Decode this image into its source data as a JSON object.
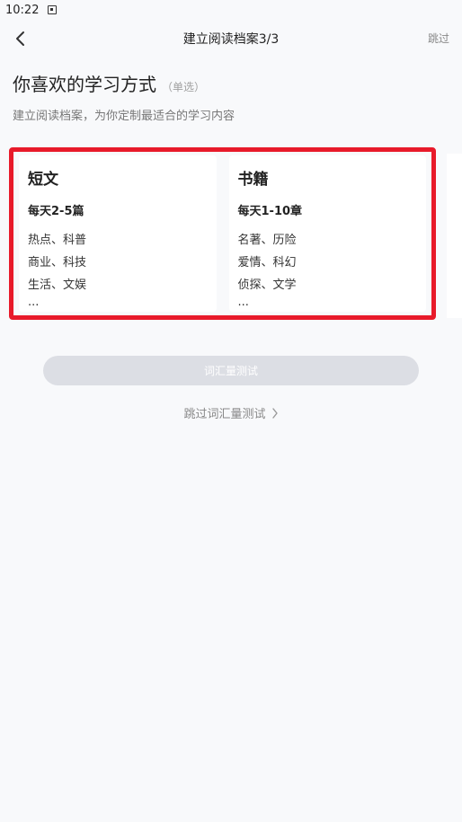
{
  "status_bar": {
    "time": "10:22",
    "notification_icon": "app-notification-icon"
  },
  "nav": {
    "back_icon": "chevron-left-icon",
    "title": "建立阅读档案3/3",
    "skip_label": "跳过"
  },
  "heading": {
    "title": "你喜欢的学习方式",
    "hint": "（单选）",
    "subtitle": "建立阅读档案，为你定制最适合的学习内容"
  },
  "options": [
    {
      "title": "短文",
      "frequency": "每天2-5篇",
      "tags": [
        "热点、科普",
        "商业、科技",
        "生活、文娱"
      ],
      "more": "..."
    },
    {
      "title": "书籍",
      "frequency": "每天1-10章",
      "tags": [
        "名著、历险",
        "爱情、科幻",
        "侦探、文学"
      ],
      "more": "..."
    }
  ],
  "actions": {
    "vocab_test_label": "词汇量测试",
    "skip_test_label": "跳过词汇量测试",
    "skip_test_icon": "chevron-right-icon"
  },
  "colors": {
    "highlight_border": "#E81A2A",
    "button_disabled": "#DCDEE4",
    "title_highlight": "#FBE3B8"
  }
}
